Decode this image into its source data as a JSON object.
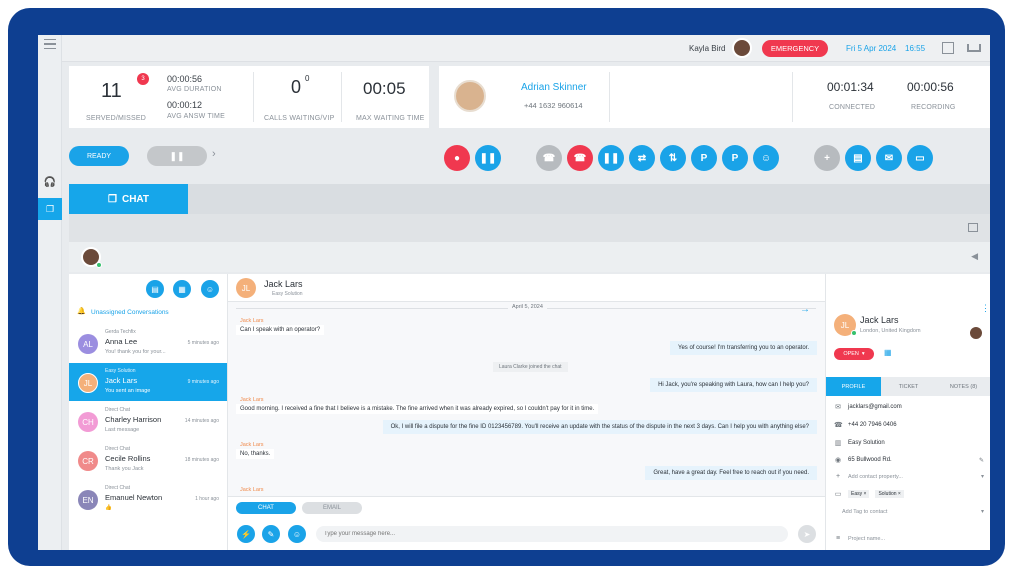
{
  "header": {
    "user_name": "Kayla Bird",
    "emergency_label": "EMERGENCY",
    "date": "Fri 5 Apr 2024",
    "time": "16:55"
  },
  "stats": {
    "served": "11",
    "missed_badge": "3",
    "served_label": "SERVED/MISSED",
    "avg_duration": "00:00:56",
    "avg_duration_label": "AVG DURATION",
    "avg_answ": "00:00:12",
    "avg_answ_label": "AVG ANSW TIME",
    "calls_waiting": "0",
    "vip": "0",
    "calls_waiting_label": "CALLS WAITING/VIP",
    "max_wait": "00:05",
    "max_wait_label": "MAX WAITING TIME"
  },
  "call": {
    "caller_name": "Adrian Skinner",
    "caller_phone": "+44 1632 960614",
    "connected": "00:01:34",
    "connected_label": "CONNECTED",
    "recording": "00:00:56",
    "recording_label": "RECORDING"
  },
  "controls": {
    "ready_label": "READY",
    "park_label": "P",
    "transfer_park_label": "P"
  },
  "tabs": {
    "chat_label": "CHAT"
  },
  "list": {
    "section_title": "Unassigned Conversations",
    "items": [
      {
        "initials": "AL",
        "source": "Gerda Techfix",
        "name": "Anna Lee",
        "message": "You! thank you for your...",
        "time": "5 minutes ago",
        "color": "#9b8ee0"
      },
      {
        "initials": "JL",
        "source": "Easy Solution",
        "name": "Jack Lars",
        "message": "You sent an image",
        "time": "9 minutes ago",
        "color": "#f4b07a"
      },
      {
        "initials": "CH",
        "source": "Direct Chat",
        "name": "Charley Harrison",
        "message": "Last message",
        "time": "14 minutes ago",
        "color": "#f29bd5"
      },
      {
        "initials": "CR",
        "source": "Direct Chat",
        "name": "Cecile Rollins",
        "message": "Thank you Jack",
        "time": "18 minutes ago",
        "color": "#f08a8a"
      },
      {
        "initials": "EN",
        "source": "Direct Chat",
        "name": "Emanuel Newton",
        "message": "👍",
        "time": "1 hour ago",
        "color": "#8a86b8"
      }
    ]
  },
  "chat": {
    "contact_initials": "JL",
    "contact_name": "Jack Lars",
    "contact_company": "Easy Solution",
    "date_divider": "April 5, 2024",
    "sender_name": "Jack Lars",
    "msg1": "Can I speak with an operator?",
    "msg2": "Yes of course! I'm transferring you to an operator.",
    "sys1": "Laura Clarke joined the chat",
    "msg3": "Hi Jack, you're speaking with Laura, how can I help you?",
    "msg4": "Good morning. I received a fine that I believe is a mistake. The fine arrived when it was already expired, so I couldn't pay for it in time.",
    "msg5": "Ok, I will file a dispute for the fine ID 0123456789. You'll receive an update with the status of the dispute in the next 3 days. Can I help you with anything else?",
    "msg6": "No, thanks.",
    "msg7": "Great, have a great day. Feel free to reach out if you need.",
    "tab_chat": "CHAT",
    "tab_email": "EMAIL",
    "input_placeholder": "Type your message here..."
  },
  "profile": {
    "initials": "JL",
    "name": "Jack Lars",
    "location": "London, United Kingdom",
    "status": "OPEN",
    "tab_profile": "PROFILE",
    "tab_ticket": "TICKET",
    "tab_notes": "NOTES (8)",
    "email": "jacklars@gmail.com",
    "phone": "+44 20 7946 0406",
    "company": "Easy Solution",
    "address": "65 Bullwood Rd.",
    "add_property": "Add contact property...",
    "tag1": "Easy",
    "tag2": "Solution",
    "add_tag": "Add Tag to contact",
    "project_name": "Project name..."
  }
}
